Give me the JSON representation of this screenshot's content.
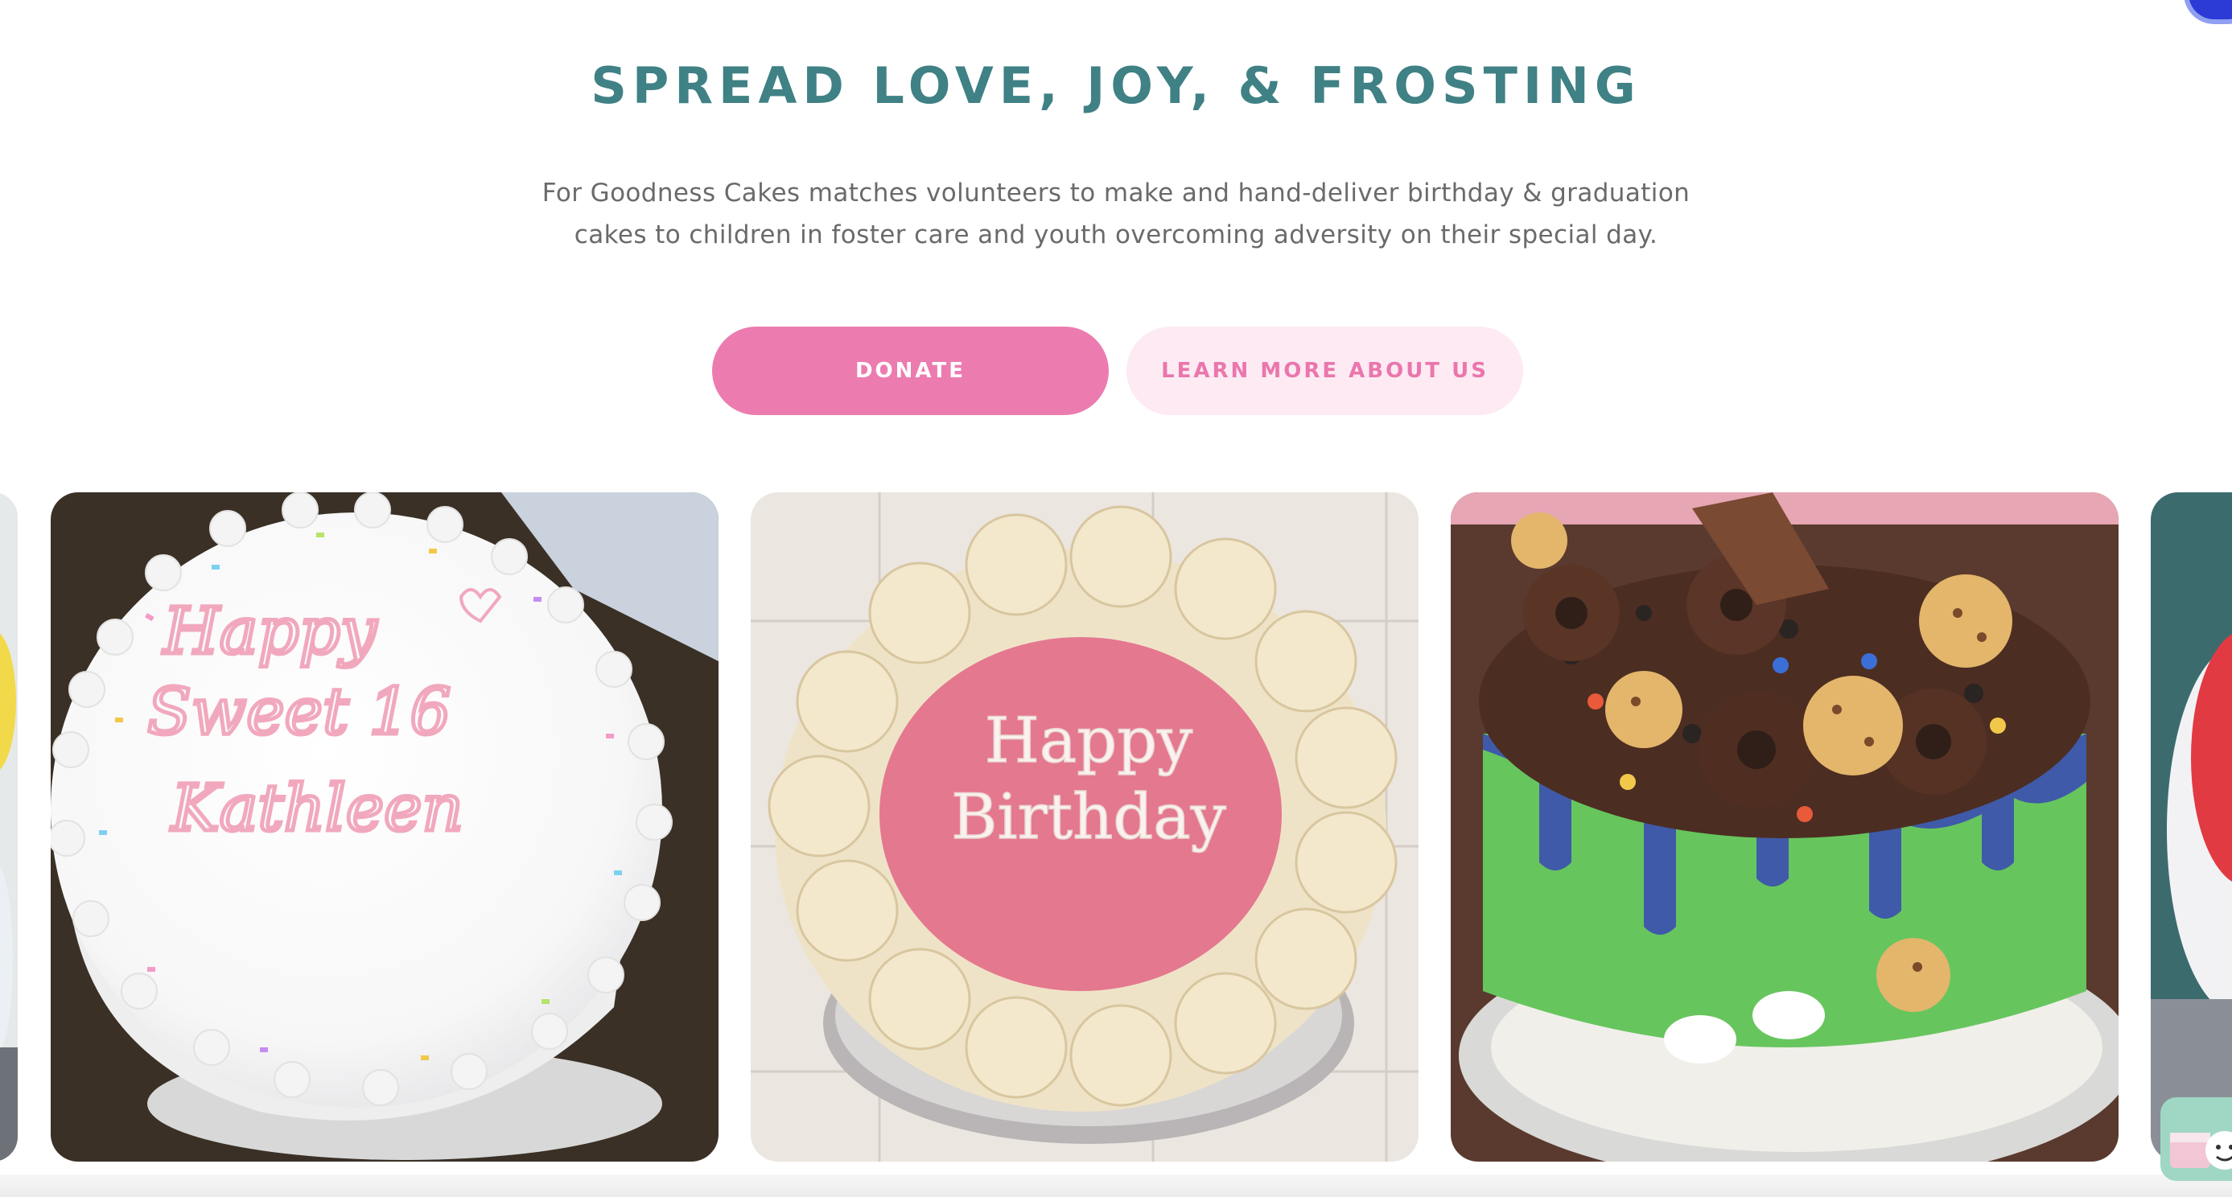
{
  "hero": {
    "title": "SPREAD LOVE, JOY, & FROSTING",
    "description": "For Goodness Cakes matches volunteers to make and hand-deliver birthday & graduation cakes to children in foster care and youth overcoming adversity on their special day.",
    "buttons": {
      "donate": "DONATE",
      "learn_more": "LEARN MORE ABOUT US"
    }
  },
  "gallery": {
    "cakes": [
      {
        "icon": "sweet-16-cake-photo",
        "inscription_line1": "Happy",
        "inscription_line2": "Sweet 16",
        "inscription_line3": "Kathleen"
      },
      {
        "icon": "happy-birthday-cake-photo",
        "inscription_line1": "Happy",
        "inscription_line2": "Birthday"
      },
      {
        "icon": "donut-cookie-drip-cake-photo"
      }
    ]
  },
  "colors": {
    "title": "#3f8185",
    "donate_button": "#ec7cb0",
    "learn_more_button_bg": "#fdeaf3",
    "learn_more_button_text": "#ea76ac"
  }
}
